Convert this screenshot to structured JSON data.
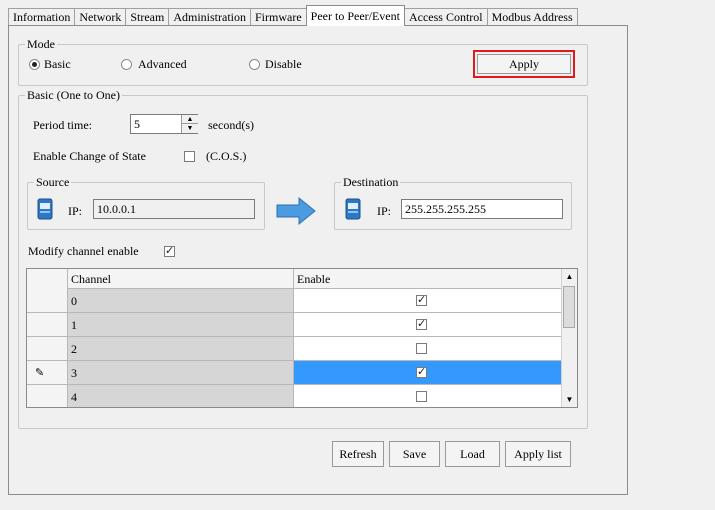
{
  "tabs": [
    "Information",
    "Network",
    "Stream",
    "Administration",
    "Firmware",
    "Peer to Peer/Event",
    "Access Control",
    "Modbus Address"
  ],
  "active_tab": "Peer to Peer/Event",
  "mode": {
    "legend": "Mode",
    "options": [
      "Basic",
      "Advanced",
      "Disable"
    ],
    "selected": "Basic",
    "apply_label": "Apply"
  },
  "basic": {
    "legend": "Basic (One to One)",
    "period_label": "Period time:",
    "period_value": "5",
    "period_unit": "second(s)",
    "cos_label": "Enable Change of State",
    "cos_checkbox_label": "(C.O.S.)",
    "cos_checked": false,
    "source": {
      "legend": "Source",
      "ip_label": "IP:",
      "ip_value": "10.0.0.1"
    },
    "destination": {
      "legend": "Destination",
      "ip_label": "IP:",
      "ip_value": "255.255.255.255"
    },
    "modify_label": "Modify channel enable",
    "modify_checked": true
  },
  "grid": {
    "columns": [
      "Channel",
      "Enable"
    ],
    "rows": [
      {
        "channel": "0",
        "enabled": true
      },
      {
        "channel": "1",
        "enabled": true
      },
      {
        "channel": "2",
        "enabled": false
      },
      {
        "channel": "3",
        "enabled": true,
        "selected": true
      },
      {
        "channel": "4",
        "enabled": false
      }
    ]
  },
  "buttons": {
    "refresh": "Refresh",
    "save": "Save",
    "load": "Load",
    "apply_list": "Apply list"
  },
  "colors": {
    "highlight_border": "#e01b1b",
    "selection": "#3399ff",
    "arrow": "#4a9be0"
  }
}
